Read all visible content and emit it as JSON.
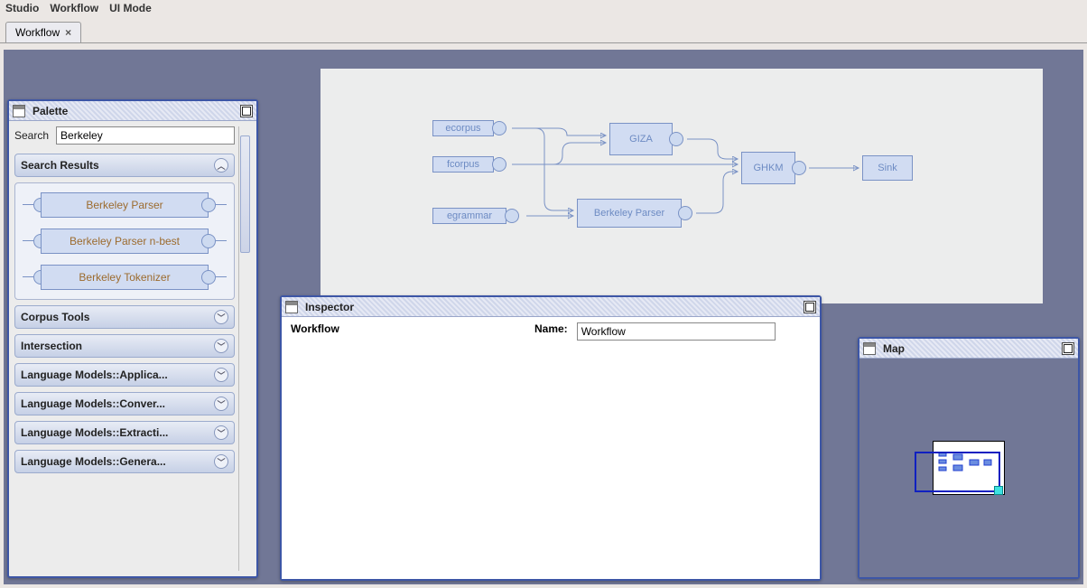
{
  "menubar": {
    "studio": "Studio",
    "workflow": "Workflow",
    "uimode": "UI Mode"
  },
  "tab": {
    "label": "Workflow",
    "close": "×"
  },
  "palette": {
    "title": "Palette",
    "search_label": "Search",
    "search_value": "Berkeley",
    "results_title": "Search Results",
    "items": [
      "Berkeley Parser",
      "Berkeley Parser n-best",
      "Berkeley Tokenizer"
    ],
    "categories": [
      "Corpus Tools",
      "Intersection",
      "Language Models::Applica...",
      "Language Models::Conver...",
      "Language Models::Extracti...",
      "Language Models::Genera..."
    ]
  },
  "diagram": {
    "nodes": {
      "ecorpus": "ecorpus",
      "fcorpus": "fcorpus",
      "egrammar": "egrammar",
      "giza": "GIZA",
      "berkeley": "Berkeley Parser",
      "ghkm": "GHKM",
      "sink": "Sink"
    }
  },
  "inspector": {
    "title": "Inspector",
    "selected": "Workflow",
    "name_label": "Name:",
    "name_value": "Workflow"
  },
  "map": {
    "title": "Map"
  }
}
